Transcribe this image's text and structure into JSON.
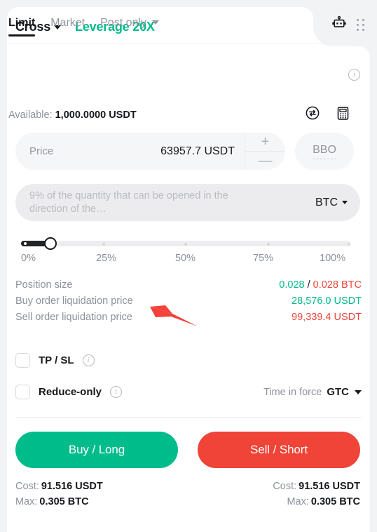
{
  "header": {
    "margin_mode": "Cross",
    "leverage": "Leverage 20X",
    "bot_icon": "robot-icon",
    "drag_handle_icon": "drag-handle-icon",
    "accent_green": "#00bc8b"
  },
  "order_type_tabs": [
    {
      "label": "Limit",
      "active": true
    },
    {
      "label": "Market",
      "active": false
    },
    {
      "label": "Post only",
      "active": false,
      "has_caret": true
    }
  ],
  "tabs_info_icon": "info-icon",
  "available": {
    "label": "Available:",
    "value": "1,000.0000 USDT",
    "swap_icon": "swap-icon",
    "calculator_icon": "calculator-icon"
  },
  "price": {
    "placeholder": "Price",
    "value": "63957.7 USDT",
    "increment_label": "+",
    "decrement_label": "—",
    "bbo_label": "BBO"
  },
  "quantity": {
    "placeholder": "9% of the quantity that can be opened in the direction of the…",
    "unit": "BTC"
  },
  "slider": {
    "value_percent": 9,
    "fill_color": "#222428",
    "ticks": [
      0,
      25,
      50,
      75,
      100
    ],
    "labels": [
      "0%",
      "25%",
      "50%",
      "75%",
      "100%"
    ]
  },
  "info_rows": [
    {
      "label": "Position size",
      "value_parts": [
        {
          "text": "0.028",
          "color": "green"
        },
        {
          "text": " / ",
          "color": "sep"
        },
        {
          "text": "0.028 BTC",
          "color": "red"
        }
      ]
    },
    {
      "label": "Buy order liquidation price",
      "value_parts": [
        {
          "text": "28,576.0 USDT",
          "color": "green"
        }
      ]
    },
    {
      "label": "Sell order liquidation price",
      "value_parts": [
        {
          "text": "99,339.4 USDT",
          "color": "red"
        }
      ]
    }
  ],
  "annotation": {
    "type": "arrow",
    "color": "#f4413a",
    "points_at": "Buy order liquidation price"
  },
  "options": {
    "tpsl_label": "TP / SL",
    "tpsl_checked": false,
    "tpsl_info_icon": "info-icon",
    "reduce_only_label": "Reduce-only",
    "reduce_only_checked": false,
    "reduce_only_info_icon": "info-icon",
    "time_in_force_label": "Time in force",
    "time_in_force_value": "GTC"
  },
  "actions": {
    "buy_label": "Buy / Long",
    "buy_color": "#00bc8b",
    "sell_label": "Sell / Short",
    "sell_color": "#ef4437"
  },
  "footer": {
    "left": {
      "cost_key": "Cost:",
      "cost_value": "91.516 USDT",
      "max_key": "Max:",
      "max_value": "0.305 BTC"
    },
    "right": {
      "cost_key": "Cost:",
      "cost_value": "91.516 USDT",
      "max_key": "Max:",
      "max_value": "0.305 BTC"
    }
  }
}
